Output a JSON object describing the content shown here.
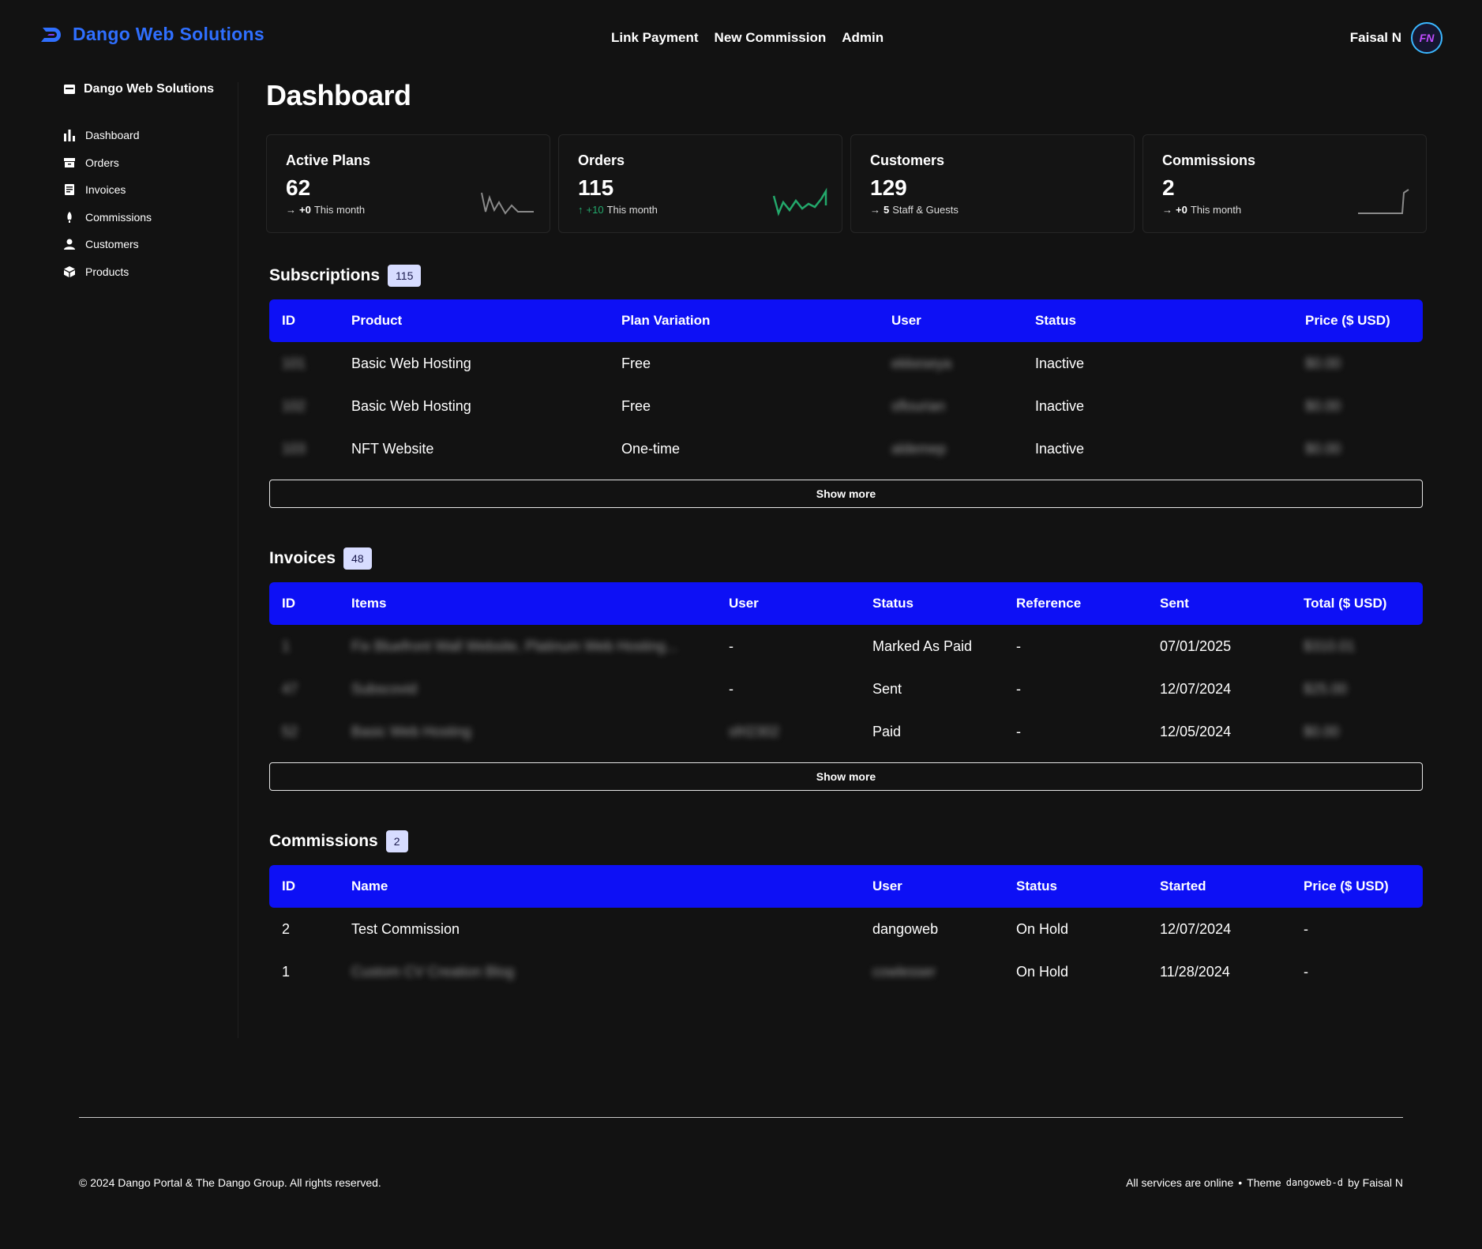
{
  "header": {
    "brand": "Dango Web Solutions",
    "nav": [
      "Link Payment",
      "New Commission",
      "Admin"
    ],
    "user_name": "Faisal N",
    "avatar_initials": "FN"
  },
  "sidebar": {
    "brand": "Dango Web Solutions",
    "items": [
      {
        "label": "Dashboard",
        "icon": "bar-chart-icon"
      },
      {
        "label": "Orders",
        "icon": "box-icon"
      },
      {
        "label": "Invoices",
        "icon": "receipt-icon"
      },
      {
        "label": "Commissions",
        "icon": "rocket-icon"
      },
      {
        "label": "Customers",
        "icon": "user-icon"
      },
      {
        "label": "Products",
        "icon": "package-icon"
      }
    ]
  },
  "main": {
    "title": "Dashboard",
    "cards": [
      {
        "title": "Active Plans",
        "value": "62",
        "change": "+0",
        "note": "This month"
      },
      {
        "title": "Orders",
        "value": "115",
        "change": "+10",
        "note": "This month"
      },
      {
        "title": "Customers",
        "value": "129",
        "change": "5",
        "note": "Staff & Guests"
      },
      {
        "title": "Commissions",
        "value": "2",
        "change": "+0",
        "note": "This month"
      }
    ]
  },
  "subscriptions": {
    "title": "Subscriptions",
    "count": "115",
    "columns": [
      "ID",
      "Product",
      "Plan Variation",
      "User",
      "Status",
      "Price ($ USD)"
    ],
    "rows": [
      [
        "101",
        "Basic Web Hosting",
        "Free",
        "ekkeseya",
        "Inactive",
        "$0.00"
      ],
      [
        "102",
        "Basic Web Hosting",
        "Free",
        "sflourian",
        "Inactive",
        "$0.00"
      ],
      [
        "103",
        "NFT Website",
        "One-time",
        "aldemep",
        "Inactive",
        "$0.00"
      ]
    ],
    "show_more": "Show more"
  },
  "invoices": {
    "title": "Invoices",
    "count": "48",
    "columns": [
      "ID",
      "Items",
      "User",
      "Status",
      "Reference",
      "Sent",
      "Total ($ USD)"
    ],
    "rows": [
      [
        "1",
        "Fix Bluefront Wall Website, Platinum Web Hosting...",
        "-",
        "Marked As Paid",
        "-",
        "07/01/2025",
        "$310.01"
      ],
      [
        "47",
        "Subscovid",
        "-",
        "Sent",
        "-",
        "12/07/2024",
        "$25.00"
      ],
      [
        "52",
        "Basic Web Hosting",
        "sfrl2302",
        "Paid",
        "-",
        "12/05/2024",
        "$0.00"
      ]
    ],
    "show_more": "Show more"
  },
  "commissions": {
    "title": "Commissions",
    "count": "2",
    "columns": [
      "ID",
      "Name",
      "User",
      "Status",
      "Started",
      "Price ($ USD)"
    ],
    "rows": [
      [
        "2",
        "Test Commission",
        "dangoweb",
        "On Hold",
        "12/07/2024",
        "-"
      ],
      [
        "1",
        "Custom CV Creation Blog",
        "cowlesser",
        "On Hold",
        "11/28/2024",
        "-"
      ]
    ]
  },
  "footer": {
    "copyright": "© 2024 Dango Portal & The Dango Group. All rights reserved.",
    "status": "All services are online",
    "separator": "•",
    "theme_label": "Theme",
    "theme_name": "dangoweb-d",
    "by": "by Faisal N"
  },
  "colors": {
    "background": "#121212",
    "accent_blue": "#0d10f5",
    "brand_blue": "#2f6fff",
    "positive_green": "#23a86b"
  }
}
